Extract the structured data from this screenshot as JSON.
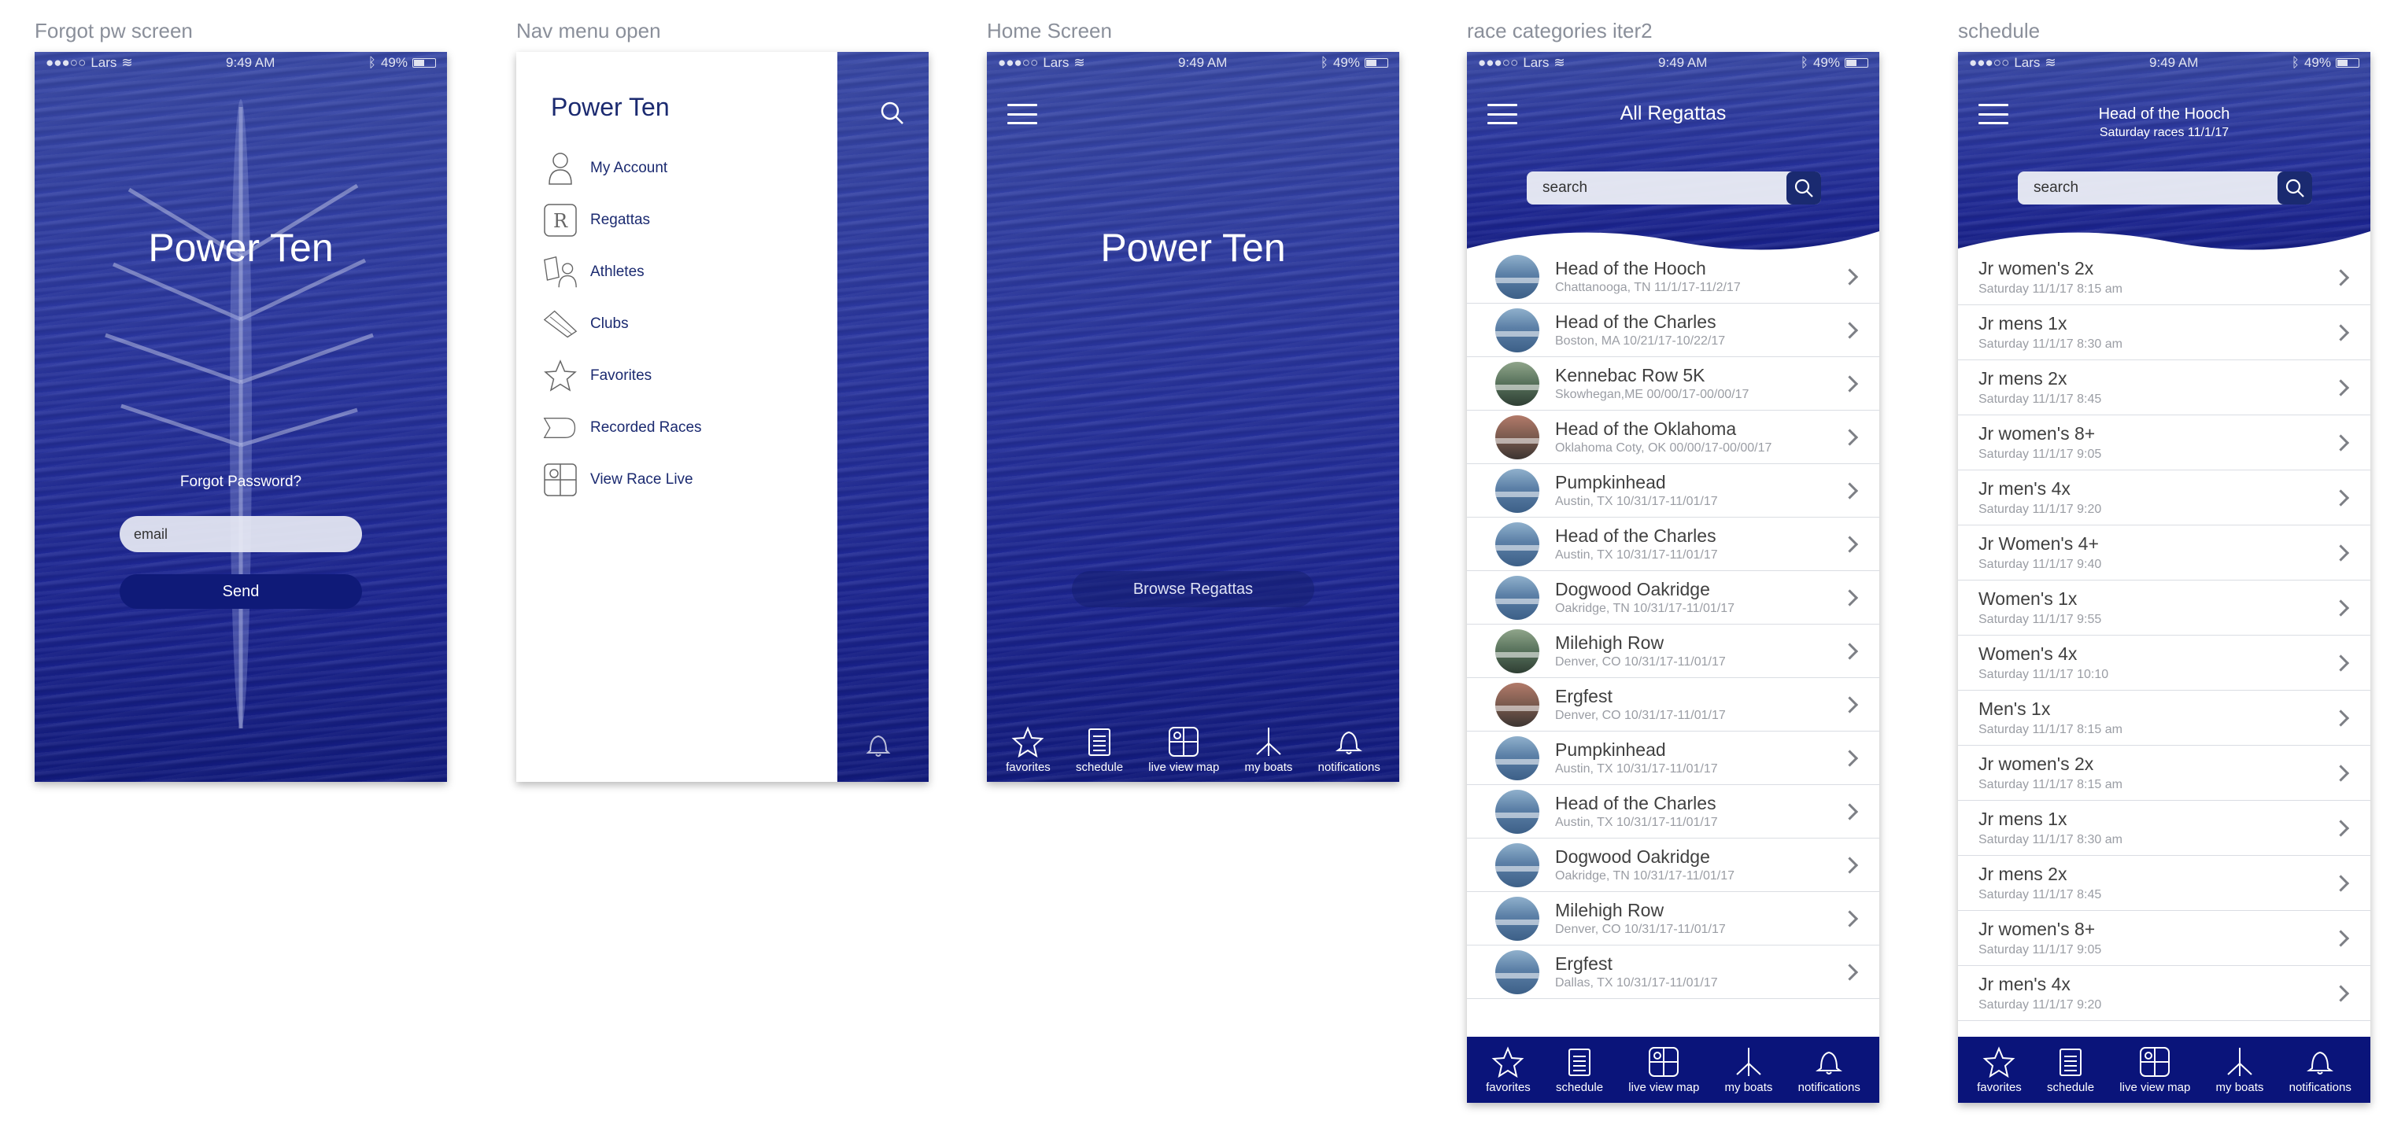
{
  "frames": {
    "forgot": "Forgot pw screen",
    "nav": "Nav menu open",
    "home": "Home Screen",
    "race": "race categories iter2",
    "schedule": "schedule"
  },
  "status": {
    "carrier": "Lars",
    "time": "9:49 AM",
    "battery": "49%"
  },
  "app_name": "Power Ten",
  "forgot": {
    "prompt": "Forgot Password?",
    "email_placeholder": "email",
    "send_label": "Send"
  },
  "nav_menu": {
    "title": "Power Ten",
    "items": [
      {
        "label": "My Account",
        "icon": "person-icon"
      },
      {
        "label": "Regattas",
        "icon": "regatta-r-icon"
      },
      {
        "label": "Athletes",
        "icon": "athletes-icon"
      },
      {
        "label": "Clubs",
        "icon": "clubs-icon"
      },
      {
        "label": "Favorites",
        "icon": "star-icon"
      },
      {
        "label": "Recorded Races",
        "icon": "recorded-races-icon"
      },
      {
        "label": "View Race Live",
        "icon": "map-icon"
      }
    ]
  },
  "home": {
    "browse_label": "Browse Regattas"
  },
  "tabs": [
    "favorites",
    "schedule",
    "live view map",
    "my boats",
    "notifications"
  ],
  "regattas": {
    "title": "All Regattas",
    "search_placeholder": "search",
    "rows": [
      {
        "name": "Head of the Hooch",
        "sub": "Chattanooga, TN  11/1/17-11/2/17",
        "thumb": "blue"
      },
      {
        "name": "Head of the Charles",
        "sub": "Boston, MA  10/21/17-10/22/17",
        "thumb": "blue"
      },
      {
        "name": "Kennebac Row 5K",
        "sub": "Skowhegan,ME 00/00/17-00/00/17",
        "thumb": "green"
      },
      {
        "name": "Head of the Oklahoma",
        "sub": "Oklahoma Coty, OK 00/00/17-00/00/17",
        "thumb": "red"
      },
      {
        "name": "Pumpkinhead",
        "sub": "Austin, TX  10/31/17-11/01/17",
        "thumb": "blue"
      },
      {
        "name": "Head of the Charles",
        "sub": "Austin, TX  10/31/17-11/01/17",
        "thumb": "blue"
      },
      {
        "name": "Dogwood Oakridge",
        "sub": "Oakridge, TN  10/31/17-11/01/17",
        "thumb": "blue"
      },
      {
        "name": "Milehigh Row",
        "sub": "Denver, CO  10/31/17-11/01/17",
        "thumb": "green"
      },
      {
        "name": "Ergfest",
        "sub": "Denver, CO  10/31/17-11/01/17",
        "thumb": "red"
      },
      {
        "name": "Pumpkinhead",
        "sub": "Austin, TX  10/31/17-11/01/17",
        "thumb": "blue"
      },
      {
        "name": "Head of the Charles",
        "sub": "Austin, TX  10/31/17-11/01/17",
        "thumb": "blue"
      },
      {
        "name": "Dogwood Oakridge",
        "sub": "Oakridge, TN  10/31/17-11/01/17",
        "thumb": "blue"
      },
      {
        "name": "Milehigh Row",
        "sub": "Denver, CO  10/31/17-11/01/17",
        "thumb": "blue"
      },
      {
        "name": "Ergfest",
        "sub": "Dallas, TX  10/31/17-11/01/17",
        "thumb": "blue"
      }
    ]
  },
  "schedule": {
    "title": "Head of the Hooch",
    "subtitle": "Saturday races 11/1/17",
    "search_placeholder": "search",
    "rows": [
      {
        "name": "Jr women's 2x",
        "sub": "Saturday 11/1/17 8:15 am"
      },
      {
        "name": "Jr mens 1x",
        "sub": "Saturday 11/1/17 8:30 am"
      },
      {
        "name": "Jr mens 2x",
        "sub": "Saturday 11/1/17 8:45"
      },
      {
        "name": "Jr women's 8+",
        "sub": "Saturday 11/1/17 9:05"
      },
      {
        "name": "Jr men's 4x",
        "sub": "Saturday 11/1/17 9:20"
      },
      {
        "name": "Jr Women's 4+",
        "sub": "Saturday 11/1/17 9:40"
      },
      {
        "name": "Women's 1x",
        "sub": "Saturday 11/1/17 9:55"
      },
      {
        "name": "Women's 4x",
        "sub": "Saturday 11/1/17 10:10"
      },
      {
        "name": "Men's 1x",
        "sub": "Saturday 11/1/17 8:15 am"
      },
      {
        "name": "Jr women's 2x",
        "sub": "Saturday 11/1/17 8:15 am"
      },
      {
        "name": "Jr mens 1x",
        "sub": "Saturday 11/1/17 8:30 am"
      },
      {
        "name": "Jr mens 2x",
        "sub": "Saturday 11/1/17 8:45"
      },
      {
        "name": "Jr women's 8+",
        "sub": "Saturday 11/1/17 9:05"
      },
      {
        "name": "Jr men's 4x",
        "sub": "Saturday 11/1/17 9:20"
      }
    ]
  },
  "colors": {
    "brand_navy": "#0a147a",
    "water": "#2a36a0",
    "menu_text": "#1b2a70"
  }
}
